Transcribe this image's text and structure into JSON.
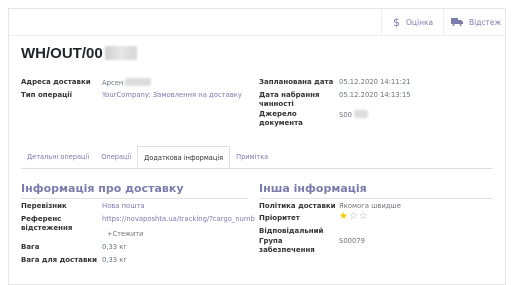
{
  "top_buttons": {
    "valuation": {
      "label": "Оцінка",
      "icon": "dollar-icon"
    },
    "tracking": {
      "label": "Відстеж",
      "icon": "truck-icon"
    }
  },
  "title": "WH/OUT/00",
  "fields_left": [
    {
      "label": "Адреса доставки",
      "value": "Арсен"
    },
    {
      "label": "Тип операції",
      "value": "YourCompany: Замовлення на доставку"
    }
  ],
  "fields_right": [
    {
      "label": "Запланована дата",
      "value": "05.12.2020 14:11:21"
    },
    {
      "label": "Дата набрання чинності",
      "value": "05.12.2020 14:13:15"
    },
    {
      "label": "Джерело документа",
      "value": "S00"
    }
  ],
  "tabs": [
    "Детальні операції",
    "Операції",
    "Додаткова інформація",
    "Примітка"
  ],
  "active_tab": "Додаткова інформація",
  "delivery": {
    "heading": "Інформація про доставку",
    "carrier_label": "Перевізник",
    "carrier_value": "Нова пошта",
    "ref_label": "Референс відстеження",
    "ref_value": "https://novaposhta.ua/tracking/?cargo_numb",
    "track_button": "Стежити",
    "weight_label": "Вага",
    "weight_value": "0,33 кг",
    "ship_weight_label": "Вага для доставки",
    "ship_weight_value": "0,33 кг"
  },
  "other": {
    "heading": "Інша інформація",
    "policy_label": "Політика доставки",
    "policy_value": "Якомога швидше",
    "priority_label": "Пріоритет",
    "priority_value": 1,
    "priority_max": 3,
    "responsible_label": "Відповідальний",
    "group_label": "Група забезпечення",
    "group_value": "S00079"
  }
}
